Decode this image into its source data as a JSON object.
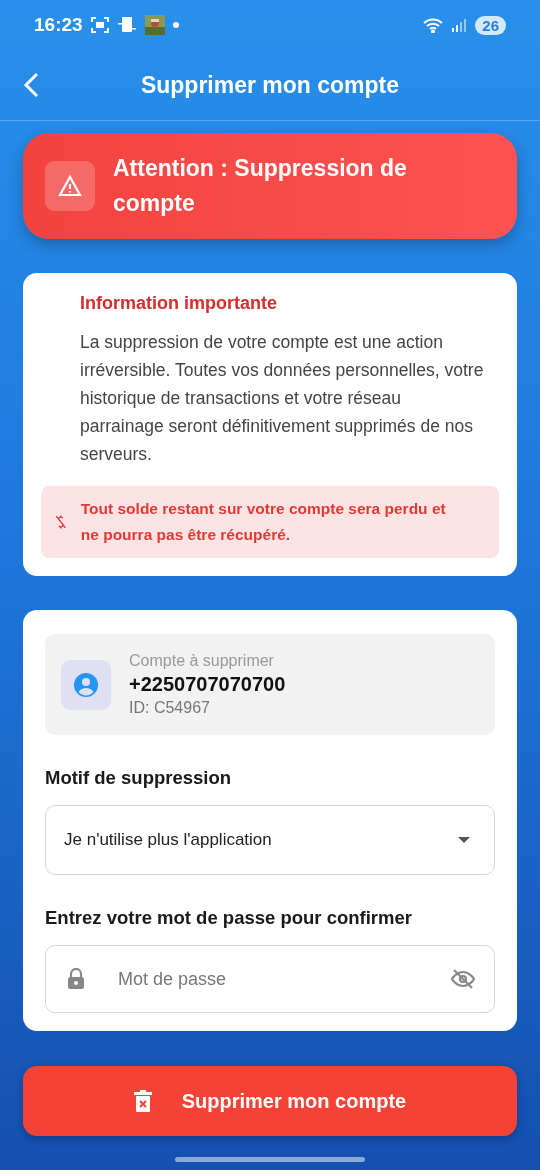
{
  "status_bar": {
    "time": "16:23",
    "battery": "26"
  },
  "header": {
    "title": "Supprimer mon compte"
  },
  "warning_banner": {
    "title": "Attention : Suppression de compte"
  },
  "info_card": {
    "title": "Information importante",
    "body": "La suppression de votre compte est une action irréversible. Toutes vos données personnelles, votre historique de transactions et votre réseau parrainage seront définitivement supprimés de nos serveurs.",
    "alert": "Tout solde restant sur votre compte sera perdu et ne pourra pas être récupéré."
  },
  "account": {
    "label": "Compte à supprimer",
    "phone": "+2250707070700",
    "id": "ID: C54967"
  },
  "reason": {
    "label": "Motif de suppression",
    "value": "Je n'utilise plus l'application"
  },
  "password": {
    "label": "Entrez votre mot de passe pour confirmer",
    "placeholder": "Mot de passe"
  },
  "delete_button": {
    "label": "Supprimer mon compte"
  }
}
